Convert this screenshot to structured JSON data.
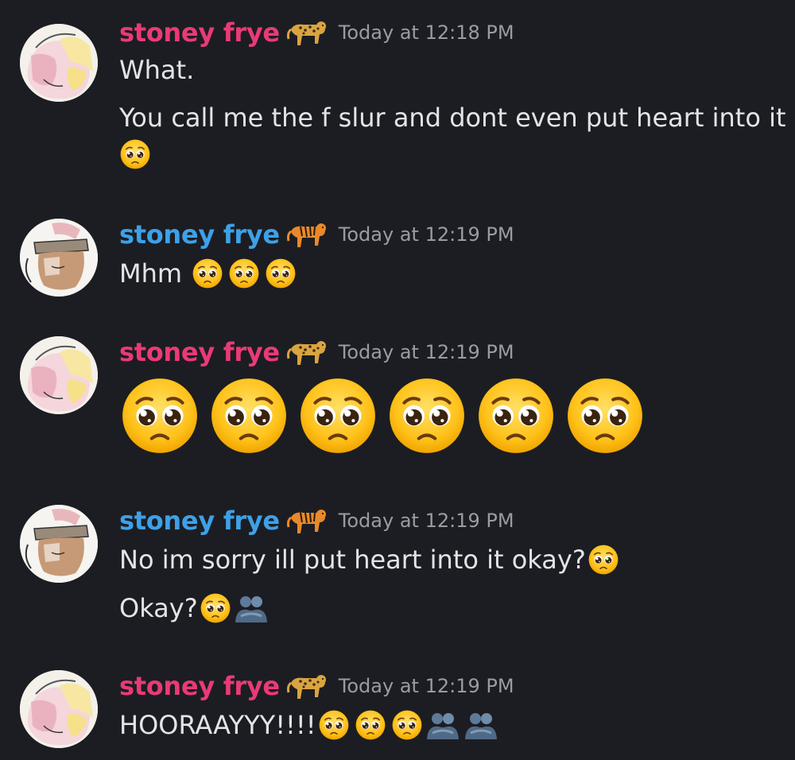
{
  "messages": [
    {
      "username": "stoney frye",
      "badge_icon": "leopard-icon",
      "timestamp": "Today at 12:18 PM",
      "lines": [
        "What.",
        "You call me the f slur and dont even put heart into it"
      ]
    },
    {
      "username": "stoney frye",
      "badge_icon": "tiger-icon",
      "timestamp": "Today at 12:19 PM",
      "lines": [
        "Mhm"
      ]
    },
    {
      "username": "stoney frye",
      "badge_icon": "leopard-icon",
      "timestamp": "Today at 12:19 PM",
      "lines": []
    },
    {
      "username": "stoney frye",
      "badge_icon": "tiger-icon",
      "timestamp": "Today at 12:19 PM",
      "lines": [
        "No im sorry ill put heart into it okay?",
        "Okay?"
      ]
    },
    {
      "username": "stoney frye",
      "badge_icon": "leopard-icon",
      "timestamp": "Today at 12:19 PM",
      "lines": [
        "HOORAAYYY!!!!"
      ]
    }
  ],
  "colors": {
    "background": "#1c1d22",
    "username_pink": "#ea3a76",
    "username_blue": "#3da1e8",
    "timestamp": "#9a9ca3",
    "text": "#e3e4e8"
  }
}
